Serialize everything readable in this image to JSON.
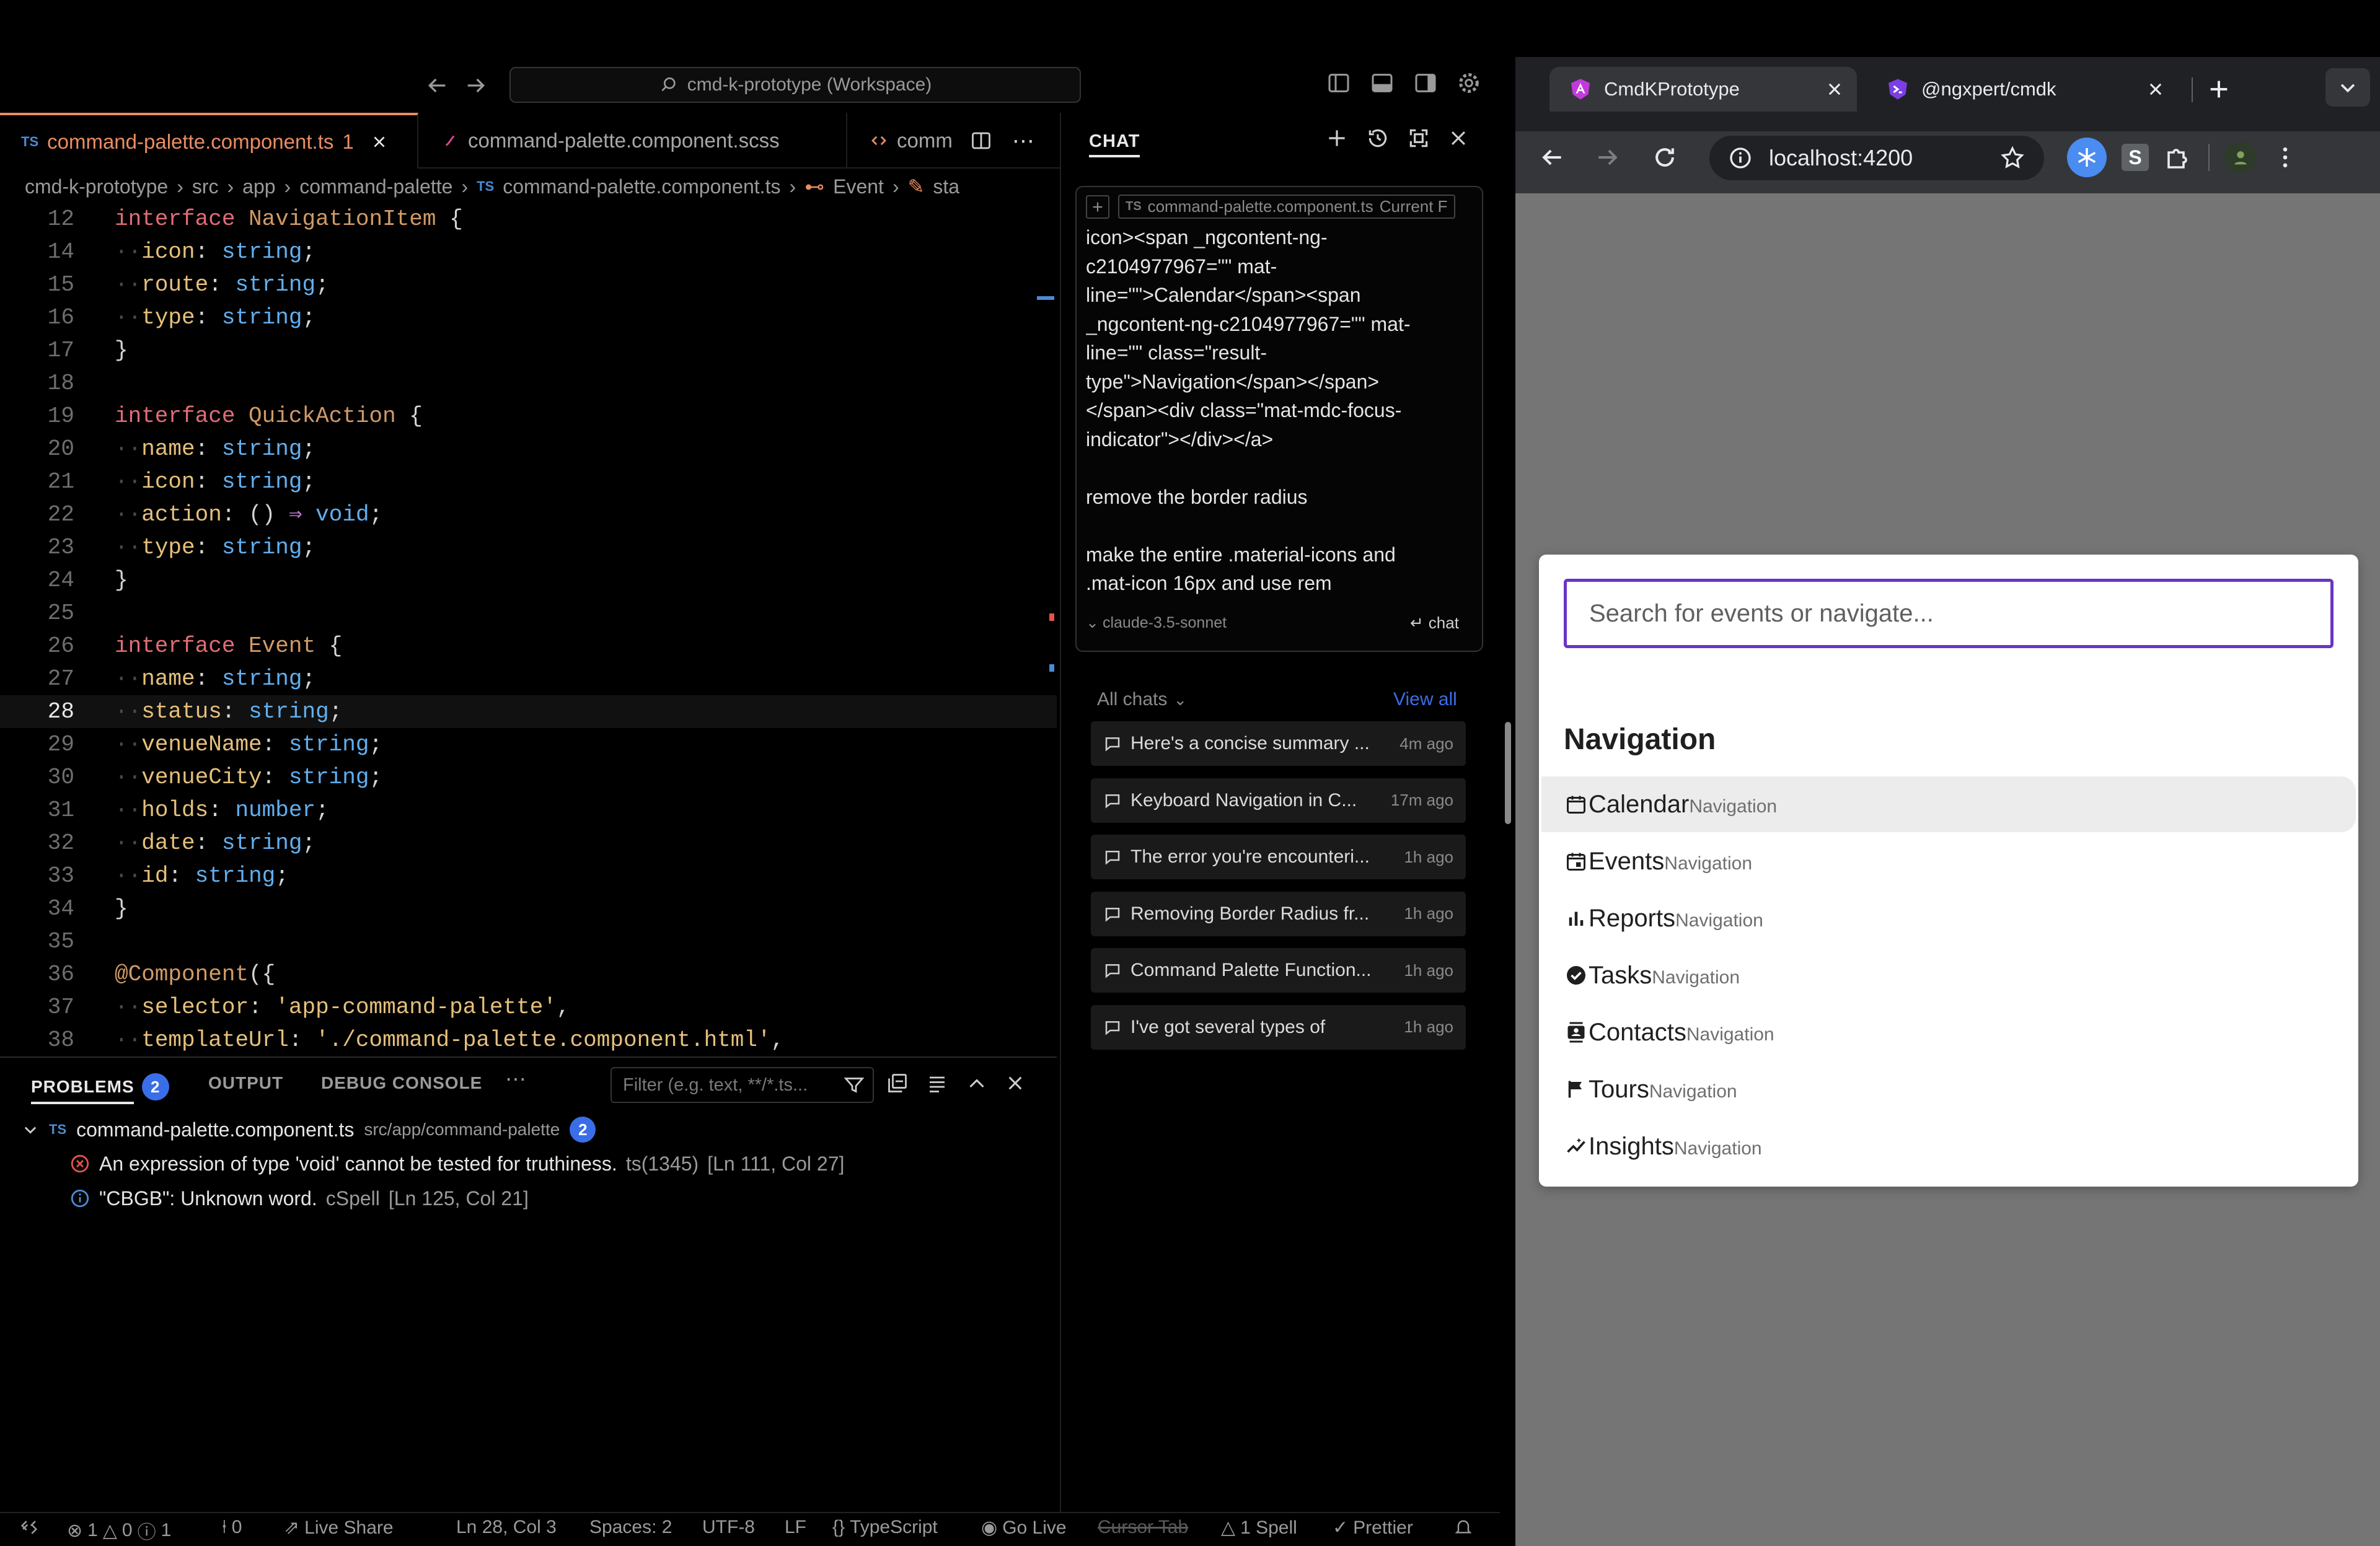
{
  "editor": {
    "title_search": "cmd-k-prototype (Workspace)",
    "tabs": [
      {
        "label": "command-palette.component.ts",
        "lang": "TS",
        "badge": "1",
        "active": true
      },
      {
        "label": "command-palette.component.scss",
        "active": false
      },
      {
        "label": "comm",
        "active": false
      }
    ],
    "breadcrumb": [
      "cmd-k-prototype",
      "src",
      "app",
      "command-palette",
      "command-palette.component.ts",
      "Event",
      "sta"
    ],
    "code_lines": [
      {
        "num": "12",
        "text": "interface NavigationItem {"
      },
      {
        "num": "14",
        "text": "  icon: string;"
      },
      {
        "num": "15",
        "text": "  route: string;"
      },
      {
        "num": "16",
        "text": "  type: string;"
      },
      {
        "num": "17",
        "text": "}"
      },
      {
        "num": "18",
        "text": ""
      },
      {
        "num": "19",
        "text": "interface QuickAction {"
      },
      {
        "num": "20",
        "text": "  name: string;"
      },
      {
        "num": "21",
        "text": "  icon: string;"
      },
      {
        "num": "22",
        "text": "  action: () ⇒ void;"
      },
      {
        "num": "23",
        "text": "  type: string;"
      },
      {
        "num": "24",
        "text": "}"
      },
      {
        "num": "25",
        "text": ""
      },
      {
        "num": "26",
        "text": "interface Event {"
      },
      {
        "num": "27",
        "text": "  name: string;"
      },
      {
        "num": "28",
        "text": "  status: string;"
      },
      {
        "num": "29",
        "text": "  venueName: string;"
      },
      {
        "num": "30",
        "text": "  venueCity: string;"
      },
      {
        "num": "31",
        "text": "  holds: number;"
      },
      {
        "num": "32",
        "text": "  date: string;"
      },
      {
        "num": "33",
        "text": "  id: string;"
      },
      {
        "num": "34",
        "text": "}"
      },
      {
        "num": "35",
        "text": ""
      },
      {
        "num": "36",
        "text": "@Component({"
      },
      {
        "num": "37",
        "text": "  selector: 'app-command-palette',"
      },
      {
        "num": "38",
        "text": "  templateUrl: './command-palette.component.html',"
      }
    ],
    "panel": {
      "tabs": [
        "PROBLEMS",
        "OUTPUT",
        "DEBUG CONSOLE"
      ],
      "problems_count": "2",
      "filter_placeholder": "Filter (e.g. text, **/*.ts...",
      "file": {
        "lang": "TS",
        "name": "command-palette.component.ts",
        "path": "src/app/command-palette",
        "count": "2"
      },
      "problems": [
        {
          "severity": "error",
          "message": "An expression of type 'void' cannot be tested for truthiness.",
          "source": "ts(1345)",
          "location": "[Ln 111, Col 27]"
        },
        {
          "severity": "info",
          "message": "\"CBGB\": Unknown word.",
          "source": "cSpell",
          "location": "[Ln 125, Col 21]"
        }
      ]
    },
    "chat": {
      "title": "CHAT",
      "context_file": "command-palette.component.ts",
      "context_label": "Current F",
      "context_lang": "TS",
      "message": "icon><span _ngcontent-ng-\nc2104977967=\"\" mat-\nline=\"\">Calendar</span><span\n_ngcontent-ng-c2104977967=\"\" mat-\nline=\"\" class=\"result-\ntype\">Navigation</span></span>\n</span><div class=\"mat-mdc-focus-\nindicator\"></div></a>\n\nremove the border radius\n\nmake the entire .material-icons and\n.mat-icon 16px and use rem",
      "model": "claude-3.5-sonnet",
      "send_label": "chat",
      "all_chats_label": "All chats",
      "view_all": "View all",
      "history": [
        {
          "title": "Here's a concise summary ...",
          "ago": "4m ago"
        },
        {
          "title": "Keyboard Navigation in C...",
          "ago": "17m ago"
        },
        {
          "title": "The error you're encounteri...",
          "ago": "1h ago"
        },
        {
          "title": "Removing Border Radius fr...",
          "ago": "1h ago"
        },
        {
          "title": "Command Palette Function...",
          "ago": "1h ago"
        },
        {
          "title": "I've got several types of",
          "ago": "1h ago"
        }
      ]
    },
    "statusbar": {
      "errors": "1",
      "warnings": "0",
      "infos": "1",
      "ports": "0",
      "live_share": "Live Share",
      "position": "Ln 28, Col 3",
      "spaces": "Spaces: 2",
      "encoding": "UTF-8",
      "eol": "LF",
      "language": "TypeScript",
      "go_live": "Go Live",
      "cursor_tab": "Cursor Tab",
      "spell": "1 Spell",
      "prettier": "Prettier"
    }
  },
  "browser": {
    "tabs": [
      {
        "label": "CmdKPrototype",
        "active": true
      },
      {
        "label": "@ngxpert/cmdk",
        "active": false
      }
    ],
    "url": "localhost:4200",
    "extension_letter": "S",
    "palette": {
      "placeholder": "Search for events or navigate...",
      "heading": "Navigation",
      "items": [
        {
          "label": "Calendar",
          "type": "Navigation",
          "icon": "calendar-icon",
          "highlighted": true
        },
        {
          "label": "Events",
          "type": "Navigation",
          "icon": "event-icon",
          "highlighted": false
        },
        {
          "label": "Reports",
          "type": "Navigation",
          "icon": "bar-chart-icon",
          "highlighted": false
        },
        {
          "label": "Tasks",
          "type": "Navigation",
          "icon": "check-circle-icon",
          "highlighted": false
        },
        {
          "label": "Contacts",
          "type": "Navigation",
          "icon": "contacts-icon",
          "highlighted": false
        },
        {
          "label": "Tours",
          "type": "Navigation",
          "icon": "flag-icon",
          "highlighted": false
        },
        {
          "label": "Insights",
          "type": "Navigation",
          "icon": "insights-icon",
          "highlighted": false
        }
      ]
    }
  },
  "colors": {
    "accent_tab": "#e98d62",
    "input_focus": "#6a35c4",
    "badge_blue": "#3a6ee8",
    "error_red": "#e5534b",
    "info_blue": "#4a8bd6"
  }
}
